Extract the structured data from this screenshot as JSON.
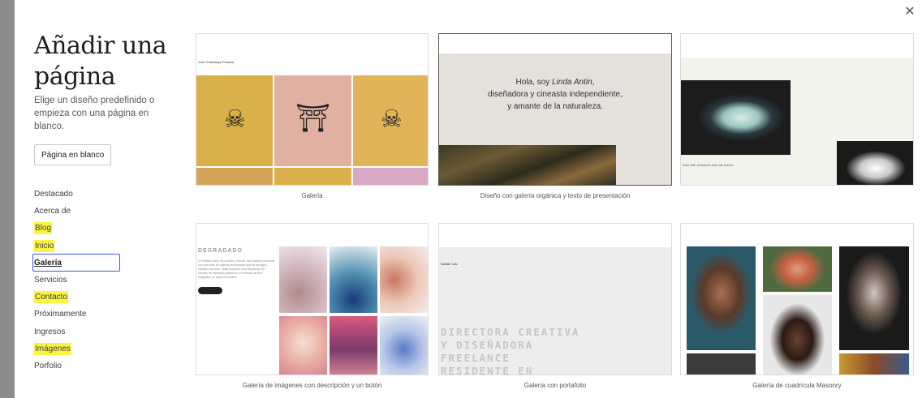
{
  "modal": {
    "title": "Añadir una página",
    "subtitle": "Elige un diseño predefinido o empieza con una página en blanco.",
    "blank_button": "Página en blanco",
    "close_icon": "close-icon"
  },
  "categories": [
    {
      "label": "Destacado",
      "highlighted": false,
      "selected": false
    },
    {
      "label": "Acerca de",
      "highlighted": false,
      "selected": false
    },
    {
      "label": "Blog",
      "highlighted": true,
      "selected": false
    },
    {
      "label": "Inicio",
      "highlighted": true,
      "selected": false
    },
    {
      "label": "Galería",
      "highlighted": false,
      "selected": true
    },
    {
      "label": "Servicios",
      "highlighted": false,
      "selected": false
    },
    {
      "label": "Contacto",
      "highlighted": true,
      "selected": false
    },
    {
      "label": "Próximamente",
      "highlighted": false,
      "selected": false
    },
    {
      "label": "Ingresos",
      "highlighted": false,
      "selected": false
    },
    {
      "label": "Imágenes",
      "highlighted": true,
      "selected": false
    },
    {
      "label": "Porfolio",
      "highlighted": false,
      "selected": false
    }
  ],
  "patterns": [
    {
      "caption": "Galería",
      "preview_name": "José Guadalupe Posada"
    },
    {
      "caption": "Diseño con galería orgánica y texto de presentación",
      "preview_text_1": "Hola, soy ",
      "preview_text_name": "Linda Antin",
      "preview_text_2": ",",
      "preview_text_3": "diseñadora y cineasta independiente,",
      "preview_text_4": "y amante de la naturaleza."
    },
    {
      "caption": "",
      "preview_small": "Dish with chestnuts and oak leaves"
    },
    {
      "caption": "Galería de imágenes con descripción y un botón",
      "preview_heading": "DEGRADADO",
      "preview_body": "Un tratado sobre los colores y formas, que vuelven al estudio con una serie de objetos encontrados que ha recogido durante sus años, hasta proponer una disposición en formato de impresión gráfica en un formato de libro tipográfico en papel de prueba.",
      "preview_button": "COMPRAR"
    },
    {
      "caption": "Galería con portafolio",
      "preview_name": "Natalie Lutz",
      "preview_big": [
        "DIRECTORA CREATIVA",
        "Y DISEÑADORA",
        "FREELANCE",
        "RESIDENTE EN"
      ]
    },
    {
      "caption": "Galería de cuadrícula Masonry"
    }
  ],
  "colors": {
    "highlight": "#fbf542",
    "selected_border": "#3858e9",
    "left_bar": "#8c8c8c"
  }
}
